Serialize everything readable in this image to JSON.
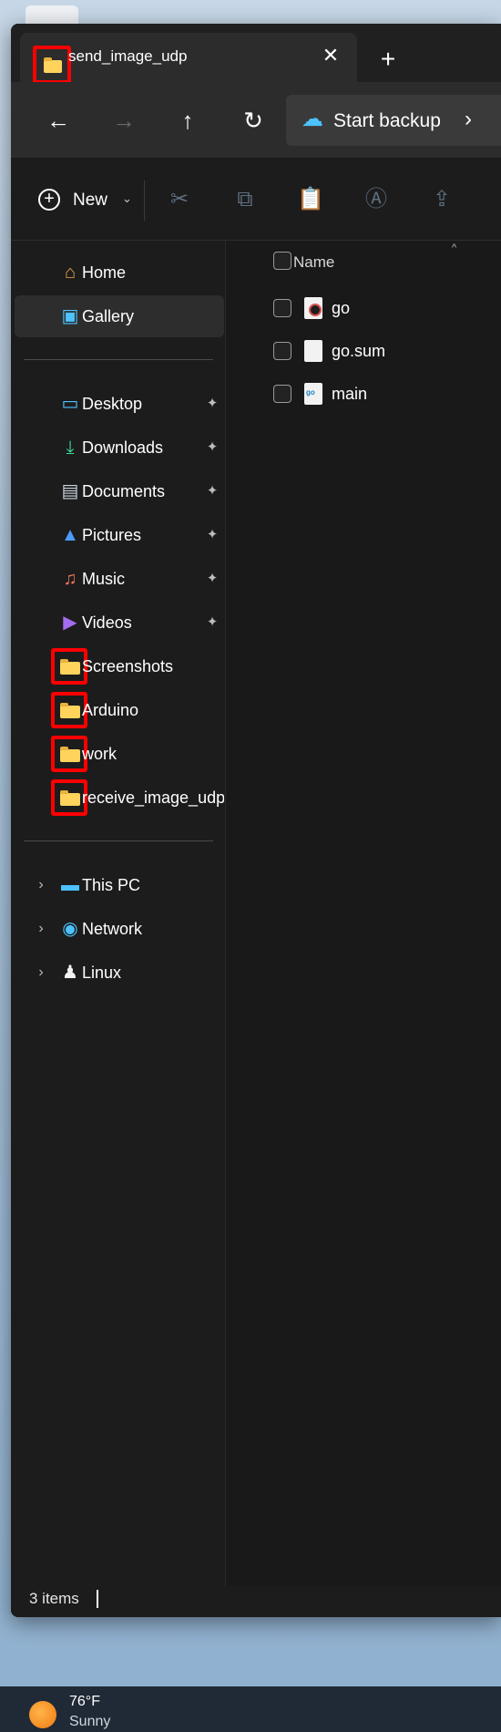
{
  "window": {
    "tab_title": "send_image_udp",
    "close_glyph": "✕",
    "new_tab_glyph": "+"
  },
  "navbar": {
    "back_glyph": "←",
    "forward_glyph": "→",
    "up_glyph": "↑",
    "refresh_glyph": "↻",
    "backup_label": "Start backup",
    "backup_chevron": "›"
  },
  "toolbar": {
    "new_label": "New",
    "new_caret": "⌄"
  },
  "sidebar": {
    "quick": [
      {
        "label": "Home",
        "icon": "home-icon"
      },
      {
        "label": "Gallery",
        "icon": "gallery-icon",
        "selected": true
      }
    ],
    "pinned": [
      {
        "label": "Desktop",
        "icon": "desktop-icon"
      },
      {
        "label": "Downloads",
        "icon": "download-icon"
      },
      {
        "label": "Documents",
        "icon": "documents-icon"
      },
      {
        "label": "Pictures",
        "icon": "pictures-icon"
      },
      {
        "label": "Music",
        "icon": "music-icon"
      },
      {
        "label": "Videos",
        "icon": "videos-icon"
      }
    ],
    "folders": [
      {
        "label": "Screenshots"
      },
      {
        "label": "Arduino"
      },
      {
        "label": "work"
      },
      {
        "label": "receive_image_udp_"
      }
    ],
    "locations": [
      {
        "label": "This PC",
        "icon": "computer-icon"
      },
      {
        "label": "Network",
        "icon": "network-icon"
      },
      {
        "label": "Linux",
        "icon": "linux-icon"
      }
    ],
    "expand_glyph": "›",
    "pin_glyph": "📌"
  },
  "main": {
    "column_name": "Name",
    "sort_caret": "^",
    "files": [
      {
        "name": "go",
        "icon": "executable-icon"
      },
      {
        "name": "go.sum",
        "icon": "file-icon"
      },
      {
        "name": "main",
        "icon": "go-file-icon"
      }
    ]
  },
  "status": {
    "item_count": "3 items"
  },
  "taskbar": {
    "temperature": "76°F",
    "condition": "Sunny"
  },
  "colors": {
    "highlight_box": "#ff0000",
    "folder": "#ffd35c",
    "accent": "#4cc2ff"
  }
}
